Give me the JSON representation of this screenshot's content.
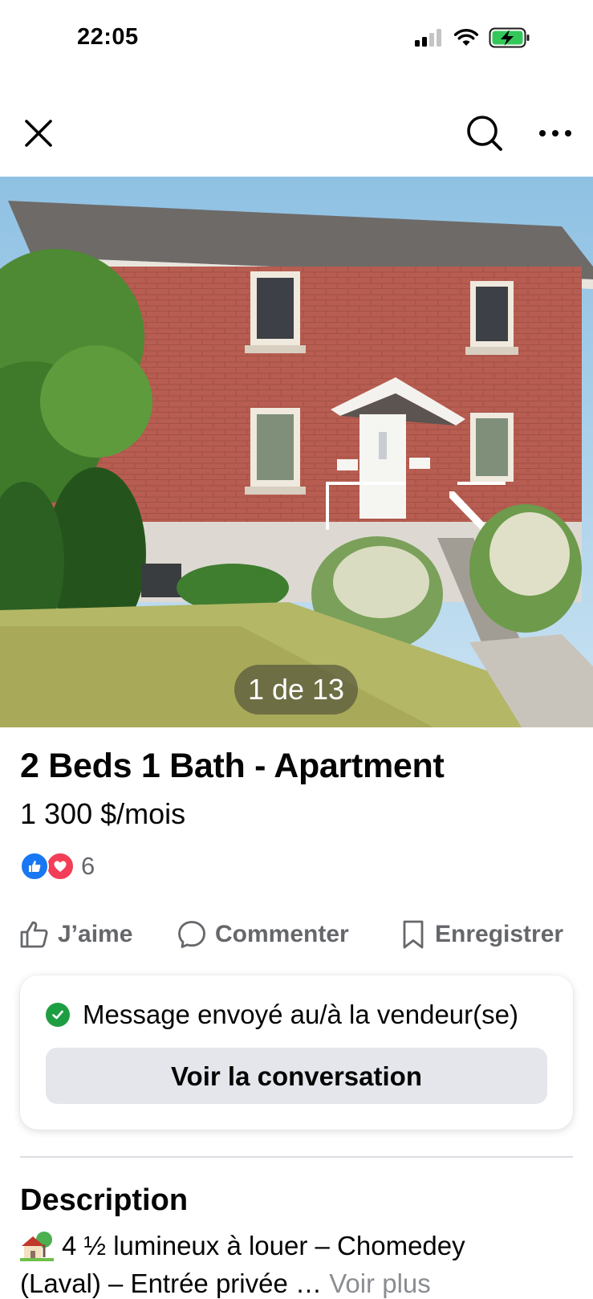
{
  "status_bar": {
    "time": "22:05",
    "icons": [
      "cellular-signal-icon",
      "wifi-icon",
      "battery-charging-icon"
    ]
  },
  "nav": {
    "icons": [
      "close-icon",
      "search-icon",
      "more-options-icon"
    ]
  },
  "photo": {
    "counter": "1 de 13"
  },
  "listing": {
    "title": "2 Beds 1 Bath - Apartment",
    "price": "1 300 $/mois",
    "reaction_count": "6"
  },
  "actions": {
    "like_label": "J’aime",
    "comment_label": "Commenter",
    "save_label": "Enregistrer"
  },
  "message": {
    "status": "Message envoyé au/à la vendeur(se)",
    "button_label": "Voir la conversation"
  },
  "description": {
    "heading": "Description",
    "line1": "4 ½ lumineux à louer – Chomedey",
    "line2": "(Laval) – Entrée privée",
    "see_more": "Voir plus"
  },
  "colors": {
    "accent_blue": "#1877f2",
    "love_red": "#f33e58",
    "success_green": "#1e9e42",
    "muted_text": "#65676b",
    "button_gray": "#e4e6eb"
  }
}
